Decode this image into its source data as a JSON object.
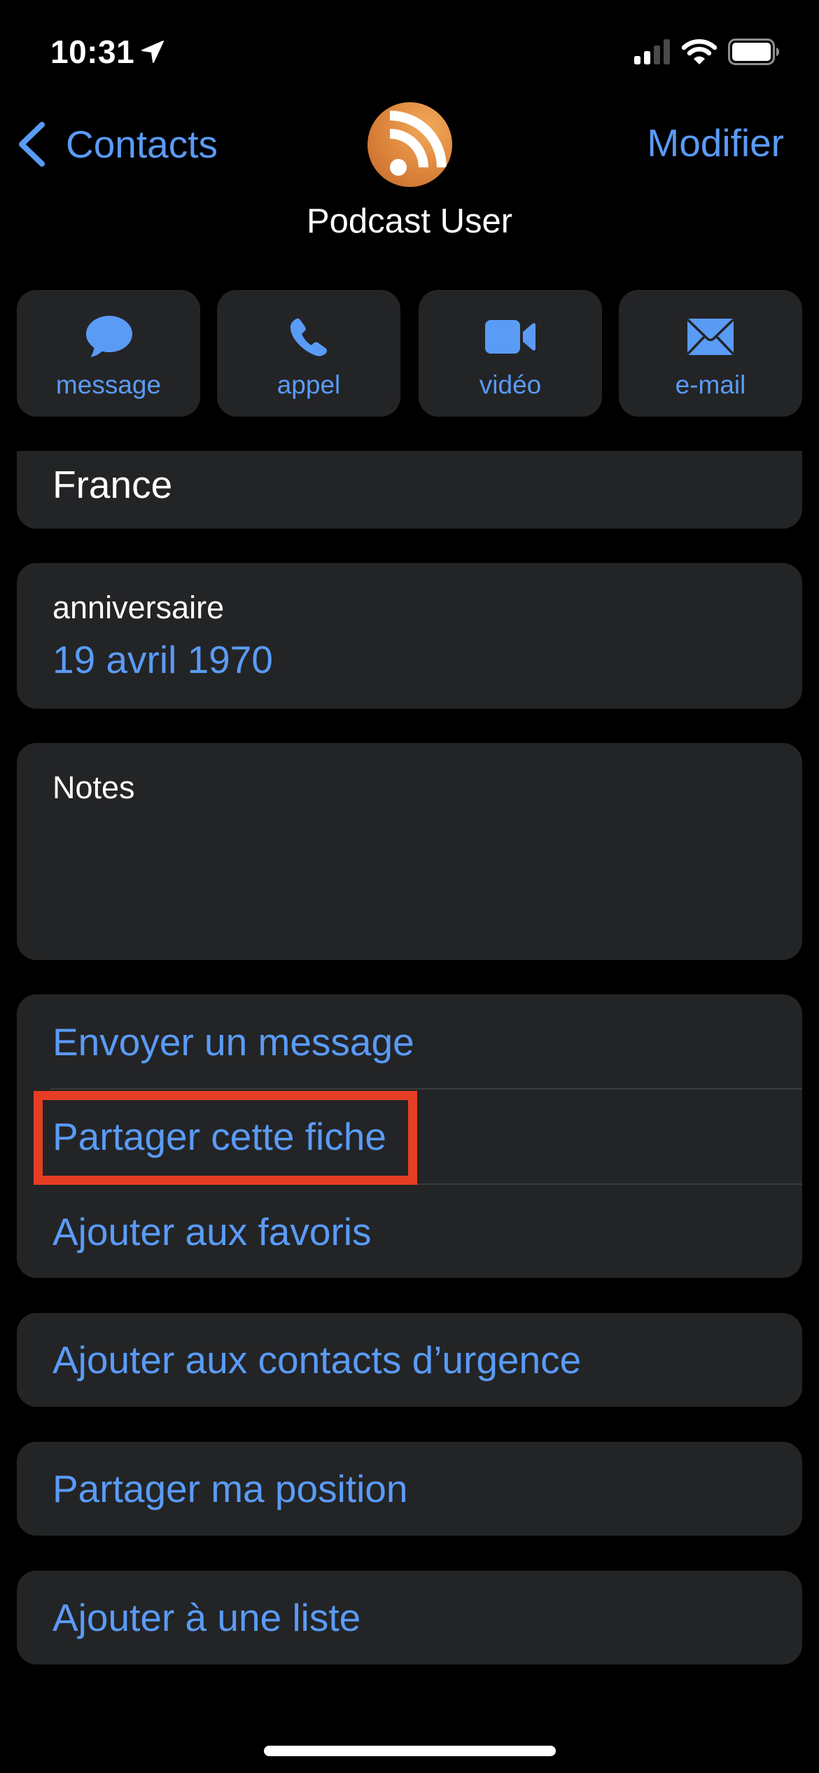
{
  "status_bar": {
    "time": "10:31",
    "location_icon": "location-arrow-icon",
    "signal_icon": "cellular-signal-icon",
    "signal_bars_active": 2,
    "signal_bars_total": 4,
    "wifi_icon": "wifi-icon",
    "battery_icon": "battery-icon",
    "battery_level": 0.85
  },
  "nav": {
    "back_icon": "chevron-left-icon",
    "back_label": "Contacts",
    "edit_label": "Modifier"
  },
  "contact": {
    "avatar_icon": "rss-podcast-icon",
    "name": "Podcast User"
  },
  "actions": [
    {
      "id": "message",
      "label": "message",
      "icon": "message-bubble-icon"
    },
    {
      "id": "call",
      "label": "appel",
      "icon": "phone-icon"
    },
    {
      "id": "video",
      "label": "vidéo",
      "icon": "video-camera-icon"
    },
    {
      "id": "email",
      "label": "e-mail",
      "icon": "envelope-icon"
    }
  ],
  "address": {
    "country": "France"
  },
  "birthday": {
    "label": "anniversaire",
    "value": "19 avril 1970"
  },
  "notes": {
    "label": "Notes",
    "value": ""
  },
  "options_group": [
    {
      "label": "Envoyer un message"
    },
    {
      "label": "Partager cette fiche",
      "highlighted": true
    },
    {
      "label": "Ajouter aux favoris"
    }
  ],
  "options_single": [
    {
      "label": "Ajouter aux contacts d’urgence"
    },
    {
      "label": "Partager ma position"
    },
    {
      "label": "Ajouter à une liste"
    }
  ],
  "colors": {
    "accent": "#5a9bf6",
    "background": "#000000",
    "card": "#232426",
    "highlight_box": "#e63e24",
    "avatar_orange": "#e08a3f"
  }
}
